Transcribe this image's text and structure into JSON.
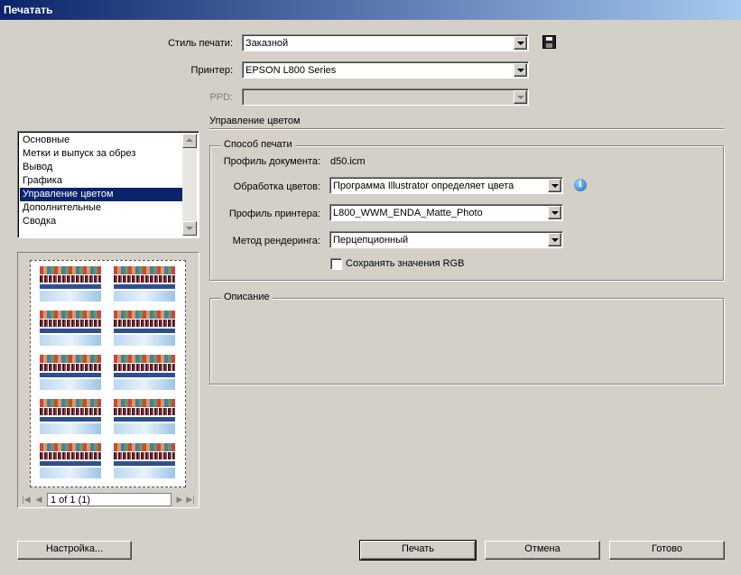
{
  "window": {
    "title": "Печатать"
  },
  "form": {
    "print_style_label": "Стиль печати:",
    "print_style_value": "Заказной",
    "printer_label": "Принтер:",
    "printer_value": "EPSON L800 Series",
    "ppd_label": "PPD:",
    "ppd_value": ""
  },
  "section": {
    "title": "Управление цветом"
  },
  "sidebar": {
    "items": [
      {
        "label": "Основные"
      },
      {
        "label": "Метки и выпуск за обрез"
      },
      {
        "label": "Вывод"
      },
      {
        "label": "Графика"
      },
      {
        "label": "Управление цветом",
        "selected": true
      },
      {
        "label": "Дополнительные"
      },
      {
        "label": "Сводка"
      }
    ]
  },
  "print_method": {
    "group_title": "Способ печати",
    "doc_profile_label": "Профиль документа:",
    "doc_profile_value": "d50.icm",
    "color_handling_label": "Обработка цветов:",
    "color_handling_value": "Программа Illustrator определяет цвета",
    "printer_profile_label": "Профиль принтера:",
    "printer_profile_value": "L800_WWM_ENDA_Matte_Photo",
    "rendering_label": "Метод рендеринга:",
    "rendering_value": "Перцепционный",
    "preserve_rgb_label": "Сохранять значения RGB",
    "preserve_rgb_checked": false
  },
  "description": {
    "group_title": "Описание"
  },
  "preview": {
    "page_indicator": "1 of 1 (1)"
  },
  "buttons": {
    "setup": "Настройка...",
    "print": "Печать",
    "cancel": "Отмена",
    "done": "Готово"
  },
  "icons": {
    "save": "save-icon",
    "info": "info-icon"
  },
  "colors": {
    "selection": "#0a246a",
    "dialog_bg": "#d4d0c8"
  }
}
